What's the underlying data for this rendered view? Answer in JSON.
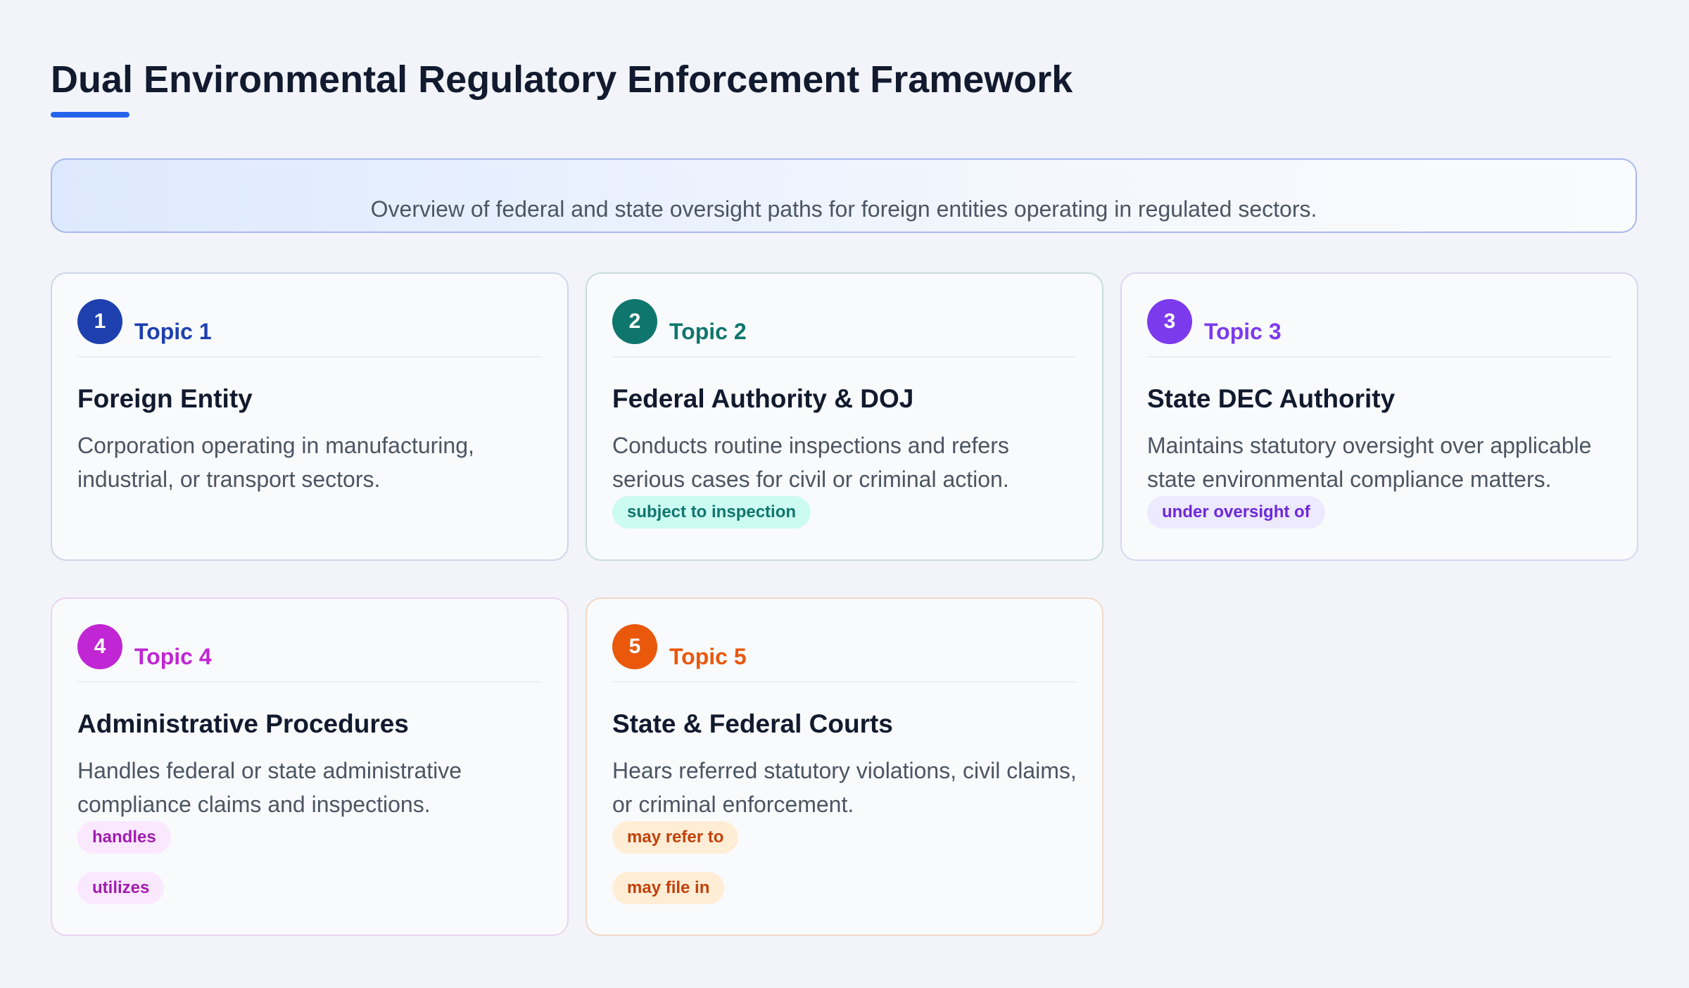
{
  "title": "Dual Environmental Regulatory Enforcement Framework",
  "overview": "Overview of federal and state oversight paths for foreign entities operating in regulated sectors.",
  "colors": {
    "accent": "#2563eb",
    "topic_1": "#1e40af",
    "topic_2": "#0f766e",
    "topic_3": "#7c3aed",
    "topic_4": "#c026d3",
    "topic_5": "#ea580c"
  },
  "cards": [
    {
      "number": "1",
      "topic": "Topic 1",
      "title": "Foreign Entity",
      "description": "Corporation operating in manufacturing, industrial, or transport sectors.",
      "tags": []
    },
    {
      "number": "2",
      "topic": "Topic 2",
      "title": "Federal Authority & DOJ",
      "description": "Conducts routine inspections and refers serious cases for civil or criminal action.",
      "tags": [
        "subject to inspection"
      ]
    },
    {
      "number": "3",
      "topic": "Topic 3",
      "title": "State DEC Authority",
      "description": "Maintains statutory oversight over applicable state environmental compliance matters.",
      "tags": [
        "under oversight of"
      ]
    },
    {
      "number": "4",
      "topic": "Topic 4",
      "title": "Administrative Procedures",
      "description": "Handles federal or state administrative compliance claims and inspections.",
      "tags": [
        "handles",
        "utilizes"
      ]
    },
    {
      "number": "5",
      "topic": "Topic 5",
      "title": "State & Federal Courts",
      "description": "Hears referred statutory violations, civil claims, or criminal enforcement.",
      "tags": [
        "may refer to",
        "may file in"
      ]
    }
  ]
}
